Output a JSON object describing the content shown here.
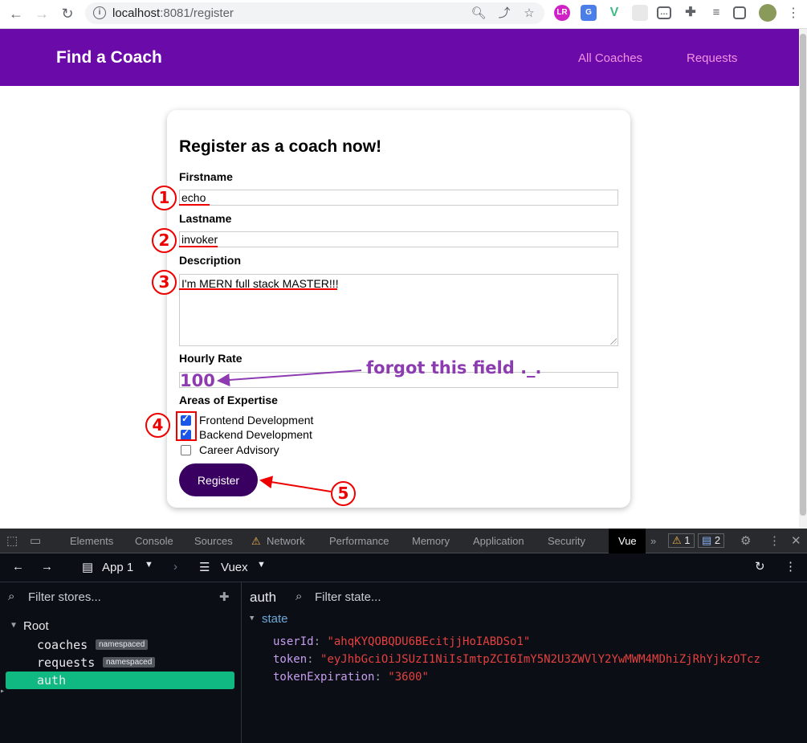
{
  "browser": {
    "url_host": "localhost",
    "url_rest": ":8081/register"
  },
  "header": {
    "brand": "Find a Coach",
    "nav": [
      "All Coaches",
      "Requests"
    ]
  },
  "form": {
    "title": "Register as a coach now!",
    "firstname_label": "Firstname",
    "firstname_value": "echo",
    "lastname_label": "Lastname",
    "lastname_value": "invoker",
    "description_label": "Description",
    "description_value": "I'm MERN full stack MASTER!!!",
    "rate_label": "Hourly Rate",
    "rate_value": "100",
    "expertise_label": "Areas of Expertise",
    "expertise": [
      {
        "label": "Frontend Development",
        "checked": true
      },
      {
        "label": "Backend Development",
        "checked": true
      },
      {
        "label": "Career Advisory",
        "checked": false
      }
    ],
    "submit_label": "Register"
  },
  "annotations": {
    "steps": [
      "1",
      "2",
      "3",
      "4",
      "5"
    ],
    "note": "forgot this field ._."
  },
  "devtools": {
    "tabs": [
      "Elements",
      "Console",
      "Sources",
      "Network",
      "Performance",
      "Memory",
      "Application",
      "Security",
      "Vue"
    ],
    "warning_count": "1",
    "message_count": "2",
    "app_label": "App 1",
    "panel_label": "Vuex",
    "filter_stores": "Filter stores...",
    "filter_state": "Filter state...",
    "selected_store": "auth",
    "tree": {
      "root": "Root",
      "items": [
        {
          "name": "coaches",
          "badge": "namespaced"
        },
        {
          "name": "requests",
          "badge": "namespaced"
        },
        {
          "name": "auth"
        }
      ]
    },
    "state_label": "state",
    "state": [
      {
        "key": "userId",
        "value": "\"ahqKYQOBQDU6BEcitjjHoIABDSo1\""
      },
      {
        "key": "token",
        "value": "\"eyJhbGciOiJSUzI1NiIsImtpZCI6ImY5N2U3ZWVlY2YwMWM4MDhiZjRhYjkzOTcz"
      },
      {
        "key": "tokenExpiration",
        "value": "\"3600\""
      }
    ]
  }
}
